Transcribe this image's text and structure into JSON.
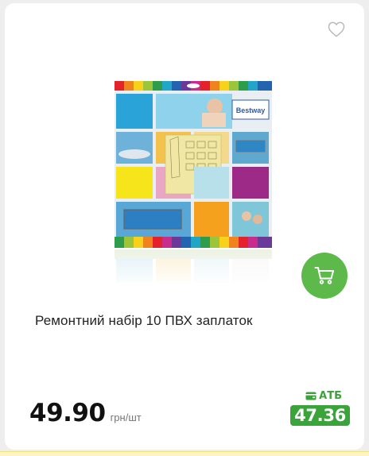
{
  "product": {
    "name": "Ремонтний набір 10 ПВХ заплаток",
    "image_brand": "Bestway",
    "price": "49.90",
    "unit": "грн/шт",
    "promo_store": "АТБ",
    "promo_price": "47.36"
  },
  "icons": {
    "favorite": "heart-outline-icon",
    "cart": "shopping-cart-icon",
    "promo_store": "card-wallet-icon"
  },
  "colors": {
    "cart_button": "#5cb94a",
    "promo_green": "#3aa33a",
    "card_background": "#ffffff",
    "page_background": "#eeeeee"
  }
}
